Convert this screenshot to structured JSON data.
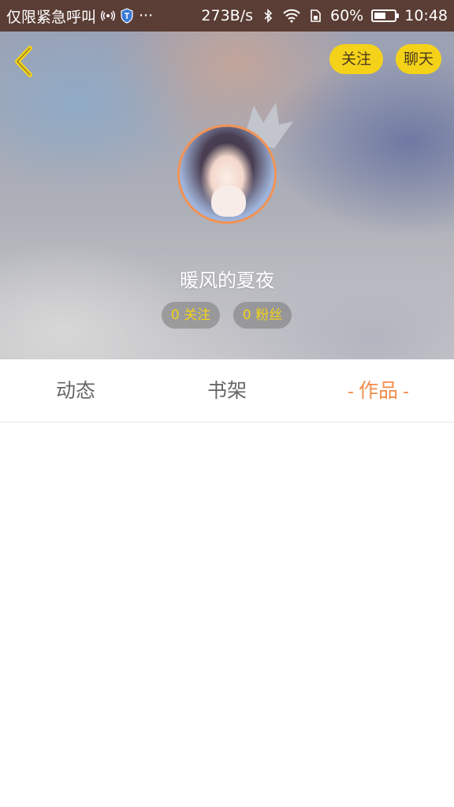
{
  "status_bar": {
    "carrier_text": "仅限紧急呼叫",
    "dots": "···",
    "network_speed": "273B/s",
    "battery_percent": "60%",
    "battery_level": 0.6,
    "time": "10:48"
  },
  "header": {
    "follow_label": "关注",
    "chat_label": "聊天"
  },
  "profile": {
    "username": "暖风的夏夜",
    "following_label": "0 关注",
    "fans_label": "0 粉丝"
  },
  "tabs": [
    {
      "label": "动态",
      "active": false
    },
    {
      "label": "书架",
      "active": false
    },
    {
      "label": "作品",
      "active": true
    }
  ],
  "colors": {
    "accent_yellow": "#f5d21a",
    "active_tab": "#f08c4a",
    "avatar_ring": "#f29355",
    "status_bar": "#5a3d34"
  }
}
